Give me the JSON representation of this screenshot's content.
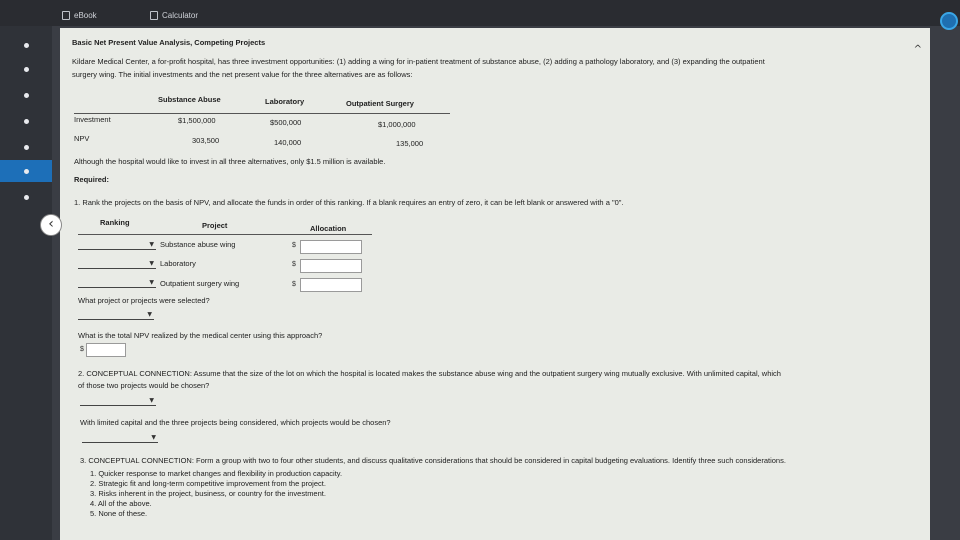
{
  "toolbar": {
    "ebook_label": "eBook",
    "calculator_label": "Calculator"
  },
  "problem": {
    "title": "Basic Net Present Value Analysis, Competing Projects",
    "intro_line1": "Kildare Medical Center, a for-profit hospital, has three investment opportunities: (1) adding a wing for in-patient treatment of substance abuse, (2) adding a pathology laboratory, and (3) expanding the outpatient",
    "intro_line2": "surgery wing. The initial investments and the net present value for the three alternatives are as follows:",
    "table": {
      "headers": [
        "Substance Abuse",
        "Laboratory",
        "Outpatient Surgery"
      ],
      "rows": [
        {
          "label": "Investment",
          "values": [
            "$1,500,000",
            "$500,000",
            "$1,000,000"
          ]
        },
        {
          "label": "NPV",
          "values": [
            "303,500",
            "140,000",
            "135,000"
          ]
        }
      ]
    },
    "note": "Although the hospital would like to invest in all three alternatives, only $1.5 million is available.",
    "required_label": "Required:"
  },
  "q1": {
    "prompt": "1.  Rank the projects on the basis of NPV, and allocate the funds in order of this ranking. If a blank requires an entry of zero, it can be left blank or answered with a \"0\".",
    "col_ranking": "Ranking",
    "col_project": "Project",
    "col_allocation": "Allocation",
    "rows": [
      {
        "project": "Substance abuse wing",
        "currency": "$"
      },
      {
        "project": "Laboratory",
        "currency": "$"
      },
      {
        "project": "Outpatient surgery wing",
        "currency": "$"
      }
    ],
    "selected_prompt": "What project or projects were selected?",
    "total_prompt": "What is the total NPV realized by the medical center using this approach?",
    "total_currency": "$"
  },
  "q2": {
    "prompt_line1": "2.  CONCEPTUAL CONNECTION: Assume that the size of the lot on which the hospital is located makes the substance abuse wing and the outpatient surgery wing mutually exclusive. With unlimited capital, which",
    "prompt_line2": "of those two projects would be chosen?",
    "limited_prompt": "With limited capital and the three projects being considered, which projects would be chosen?"
  },
  "q3": {
    "prompt": "3.  CONCEPTUAL CONNECTION: Form a group with two to four other students, and discuss qualitative considerations that should be considered in capital budgeting evaluations. Identify three such considerations.",
    "options": [
      "1.  Quicker response to market changes and flexibility in production capacity.",
      "2.  Strategic fit and long-term competitive improvement from the project.",
      "3.  Risks inherent in the project, business, or country for the investment.",
      "4.  All of the above.",
      "5.  None of these."
    ]
  },
  "icons": {
    "dropdown": "caret-down-icon",
    "back": "chevron-left-icon",
    "help": "help-circle-icon"
  }
}
